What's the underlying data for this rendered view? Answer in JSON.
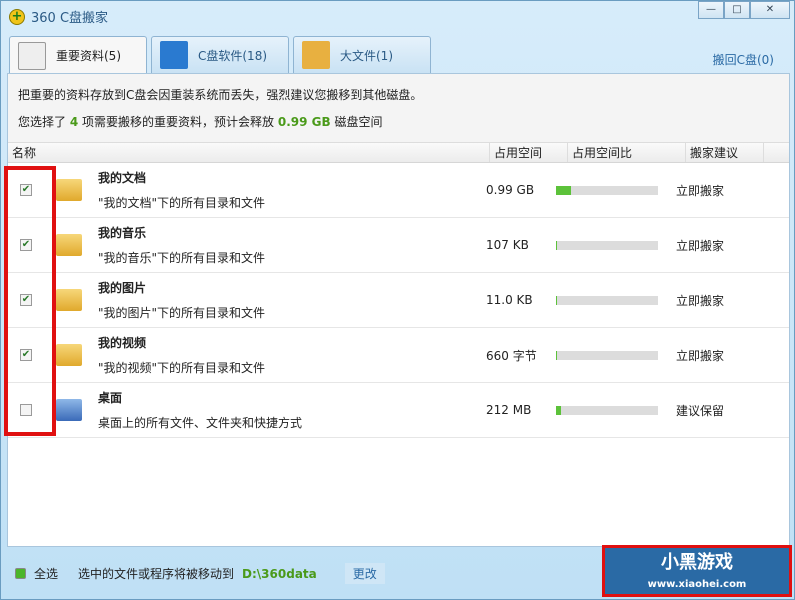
{
  "window": {
    "title": "360 C盘搬家",
    "controls": [
      "—",
      "□",
      "✕"
    ]
  },
  "tabs": [
    {
      "label": "重要资料(5)",
      "icon": "documents-star-icon"
    },
    {
      "label": "C盘软件(18)",
      "icon": "c-drive-icon"
    },
    {
      "label": "大文件(1)",
      "icon": "folder-icon"
    }
  ],
  "restore_label": "搬回C盘(0)",
  "info": {
    "line1": "把重要的资料存放到C盘会因重装系统而丢失，强烈建议您搬移到其他磁盘。",
    "pre": "您选择了",
    "count": "4",
    "mid": "项需要搬移的重要资料，预计会释放",
    "size": "0.99 GB",
    "post": "磁盘空间"
  },
  "columns": [
    "名称",
    "占用空间",
    "占用空间比",
    "搬家建议"
  ],
  "rows": [
    {
      "name": "我的文档",
      "desc": "\"我的文档\"下的所有目录和文件",
      "size": "0.99 GB",
      "ratio_percent": 15,
      "advice": "立即搬家",
      "checked": true
    },
    {
      "name": "我的音乐",
      "desc": "\"我的音乐\"下的所有目录和文件",
      "size": "107 KB",
      "ratio_percent": 1,
      "advice": "立即搬家",
      "checked": true
    },
    {
      "name": "我的图片",
      "desc": "\"我的图片\"下的所有目录和文件",
      "size": "11.0 KB",
      "ratio_percent": 1,
      "advice": "立即搬家",
      "checked": true
    },
    {
      "name": "我的视频",
      "desc": "\"我的视频\"下的所有目录和文件",
      "size": "660 字节",
      "ratio_percent": 1,
      "advice": "立即搬家",
      "checked": true
    },
    {
      "name": "桌面",
      "desc": "桌面上的所有文件、文件夹和快捷方式",
      "size": "212 MB",
      "ratio_percent": 5,
      "advice": "建议保留",
      "checked": false
    }
  ],
  "footer": {
    "select_all": "全选",
    "move_text": "选中的文件或程序将被移动到",
    "path": "D:\\360data",
    "change": "更改"
  },
  "watermark": {
    "text": "小黑游戏",
    "url": "www.xiaohei.com"
  }
}
